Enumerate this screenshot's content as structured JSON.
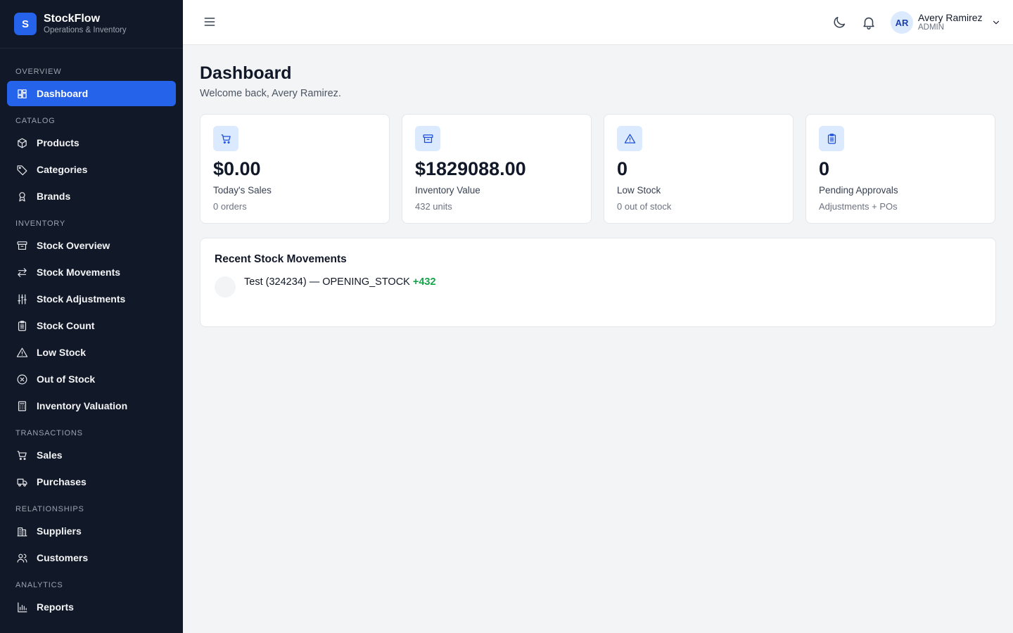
{
  "brand": {
    "logo_letter": "S",
    "name": "StockFlow",
    "subtitle": "Operations & Inventory"
  },
  "sidebar": {
    "sections": [
      {
        "label": "OVERVIEW",
        "items": [
          {
            "label": "Dashboard",
            "icon": "dashboard-icon",
            "active": true
          }
        ]
      },
      {
        "label": "CATALOG",
        "items": [
          {
            "label": "Products",
            "icon": "box-icon"
          },
          {
            "label": "Categories",
            "icon": "tag-icon"
          },
          {
            "label": "Brands",
            "icon": "award-icon"
          }
        ]
      },
      {
        "label": "INVENTORY",
        "items": [
          {
            "label": "Stock Overview",
            "icon": "archive-icon"
          },
          {
            "label": "Stock Movements",
            "icon": "arrows-exchange-icon"
          },
          {
            "label": "Stock Adjustments",
            "icon": "sliders-icon"
          },
          {
            "label": "Stock Count",
            "icon": "clipboard-icon"
          },
          {
            "label": "Low Stock",
            "icon": "warning-icon"
          },
          {
            "label": "Out of Stock",
            "icon": "x-circle-icon"
          },
          {
            "label": "Inventory Valuation",
            "icon": "calculator-icon"
          }
        ]
      },
      {
        "label": "TRANSACTIONS",
        "items": [
          {
            "label": "Sales",
            "icon": "cart-icon"
          },
          {
            "label": "Purchases",
            "icon": "truck-icon"
          }
        ]
      },
      {
        "label": "RELATIONSHIPS",
        "items": [
          {
            "label": "Suppliers",
            "icon": "building-icon"
          },
          {
            "label": "Customers",
            "icon": "users-icon"
          }
        ]
      },
      {
        "label": "ANALYTICS",
        "items": [
          {
            "label": "Reports",
            "icon": "bar-chart-icon"
          }
        ]
      }
    ]
  },
  "topbar": {
    "user": {
      "initials": "AR",
      "name": "Avery Ramirez",
      "role": "ADMIN"
    }
  },
  "page": {
    "title": "Dashboard",
    "subtitle": "Welcome back, Avery Ramirez."
  },
  "stats": [
    {
      "icon": "cart-icon",
      "value": "$0.00",
      "label": "Today's Sales",
      "meta": "0 orders"
    },
    {
      "icon": "archive-icon",
      "value": "$1829088.00",
      "label": "Inventory Value",
      "meta": "432 units"
    },
    {
      "icon": "warning-icon",
      "value": "0",
      "label": "Low Stock",
      "meta": "0 out of stock"
    },
    {
      "icon": "clipboard-icon",
      "value": "0",
      "label": "Pending Approvals",
      "meta": "Adjustments + POs"
    }
  ],
  "recent": {
    "title": "Recent Stock Movements",
    "items": [
      {
        "text": "Test (324234) — OPENING_STOCK",
        "qty": "+432"
      }
    ]
  },
  "colors": {
    "sidebar_bg": "#111827",
    "accent": "#2563eb",
    "positive": "#16a34a",
    "icon_bg": "#dbeafe"
  }
}
